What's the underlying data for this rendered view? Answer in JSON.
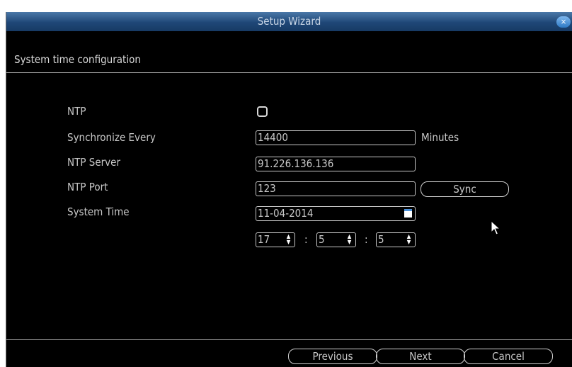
{
  "window": {
    "title": "Setup Wizard",
    "close_label": "×"
  },
  "section": {
    "title": "System time configuration"
  },
  "form": {
    "ntp_label": "NTP",
    "sync_every_label": "Synchronize Every",
    "sync_every_value": "14400",
    "sync_every_unit": "Minutes",
    "ntp_server_label": "NTP Server",
    "ntp_server_value": "91.226.136.136",
    "ntp_port_label": "NTP Port",
    "ntp_port_value": "123",
    "sync_button": "Sync",
    "system_time_label": "System Time",
    "date_value": "11-04-2014",
    "hour_value": "17",
    "minute_value": "5",
    "second_value": "5",
    "time_separator": ":"
  },
  "footer": {
    "previous": "Previous",
    "next": "Next",
    "cancel": "Cancel"
  },
  "colors": {
    "title_bar": "#1f4777",
    "background": "#000000",
    "text": "#c8c8c8",
    "accent": "#4a90d9"
  },
  "icons": {
    "checkbox": "checkbox-unchecked",
    "calendar": "calendar-icon",
    "spinner": "up-down-spinner-icon",
    "close": "close-icon",
    "cursor": "mouse-pointer-icon"
  }
}
